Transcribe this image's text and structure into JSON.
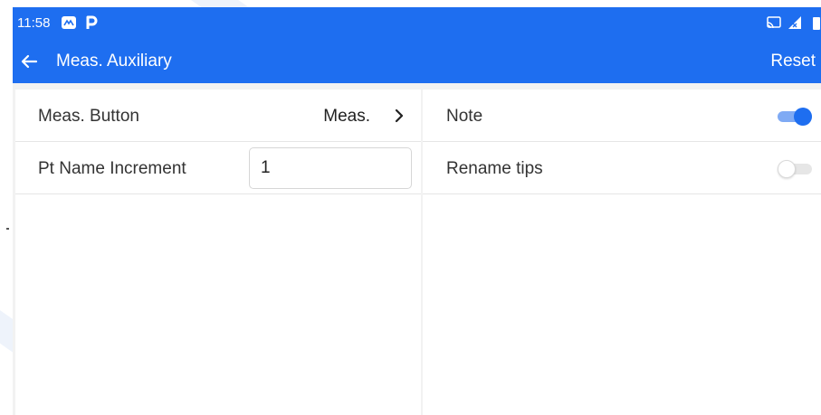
{
  "status_bar": {
    "time": "11:58",
    "icons": [
      "gallery-notification-icon",
      "parking-notification-icon",
      "cast-icon",
      "signal-icon",
      "battery-icon"
    ]
  },
  "toolbar": {
    "back_icon": "arrow-left-icon",
    "title": "Meas. Auxiliary",
    "reset_label": "Reset"
  },
  "left_panel": {
    "meas_button": {
      "label": "Meas. Button",
      "value": "Meas.",
      "icon": "chevron-right-icon"
    },
    "pt_name_increment": {
      "label": "Pt Name Increment",
      "value": "1"
    }
  },
  "right_panel": {
    "note": {
      "label": "Note",
      "enabled": true
    },
    "rename_tips": {
      "label": "Rename tips",
      "enabled": false
    }
  },
  "colors": {
    "accent": "#1e6ef0",
    "background": "#f2f2f2",
    "surface": "#ffffff",
    "switch_off_track": "#e6e6e6"
  }
}
